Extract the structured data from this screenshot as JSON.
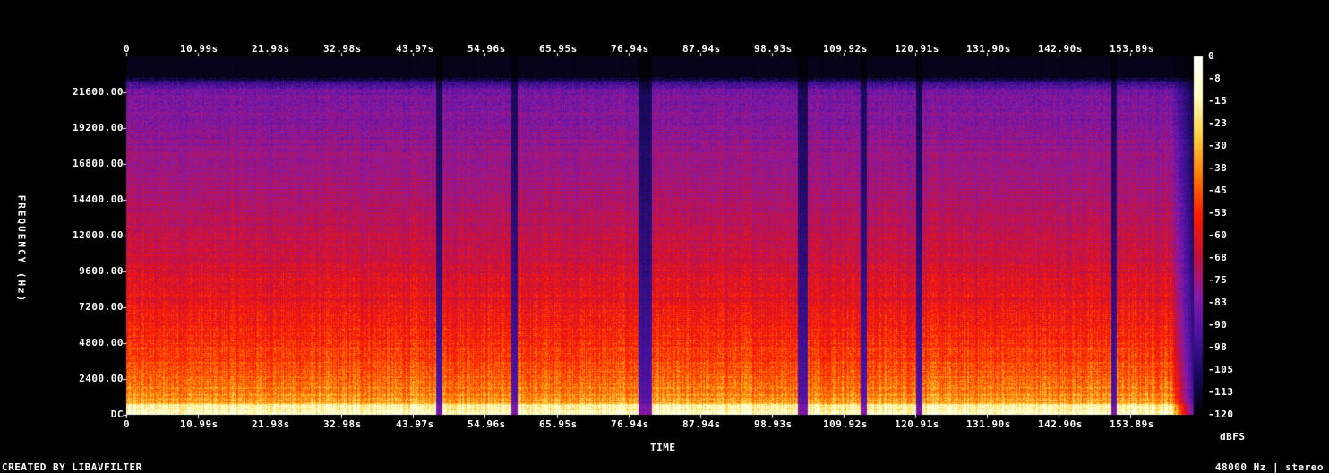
{
  "chart_data": {
    "type": "heatmap",
    "title": "",
    "xlabel": "TIME",
    "ylabel": "FREQUENCY (Hz)",
    "x_ticks": [
      "0",
      "10.99s",
      "21.98s",
      "32.98s",
      "43.97s",
      "54.96s",
      "65.95s",
      "76.94s",
      "87.94s",
      "98.93s",
      "109.92s",
      "120.91s",
      "131.90s",
      "142.90s",
      "153.89s"
    ],
    "x_tick_values": [
      0,
      10.99,
      21.98,
      32.98,
      43.97,
      54.96,
      65.95,
      76.94,
      87.94,
      98.93,
      109.92,
      120.91,
      131.9,
      142.9,
      153.89
    ],
    "y_ticks": [
      "DC",
      "2400.00",
      "4800.00",
      "7200.00",
      "9600.00",
      "12000.00",
      "14400.00",
      "16800.00",
      "19200.00",
      "21600.00"
    ],
    "y_tick_values": [
      0,
      2400,
      4800,
      7200,
      9600,
      12000,
      14400,
      16800,
      19200,
      21600
    ],
    "xlim": [
      0,
      164.7
    ],
    "ylim": [
      0,
      24000
    ],
    "colorbar_label": "dBFS",
    "colorbar_ticks": [
      "0",
      "-8",
      "-15",
      "-23",
      "-30",
      "-38",
      "-45",
      "-53",
      "-60",
      "-68",
      "-75",
      "-83",
      "-90",
      "-98",
      "-105",
      "-113",
      "-120"
    ],
    "colorbar_range": [
      -120,
      0
    ],
    "colormap": [
      "#000000",
      "#1a0a5e",
      "#4a12a0",
      "#8a1aa8",
      "#c8103a",
      "#ff1a00",
      "#ff7a00",
      "#ffd040",
      "#ffffc0",
      "#ffffff"
    ],
    "quiet_segments_s": [
      [
        47.5,
        48.5
      ],
      [
        59.0,
        60.0
      ],
      [
        78.5,
        80.5
      ],
      [
        103.0,
        104.5
      ],
      [
        112.5,
        113.5
      ],
      [
        121.0,
        122.0
      ],
      [
        151.0,
        151.8
      ]
    ],
    "grid": false
  },
  "footer": {
    "left": "CREATED BY LIBAVFILTER",
    "right": "48000 Hz | stereo"
  }
}
